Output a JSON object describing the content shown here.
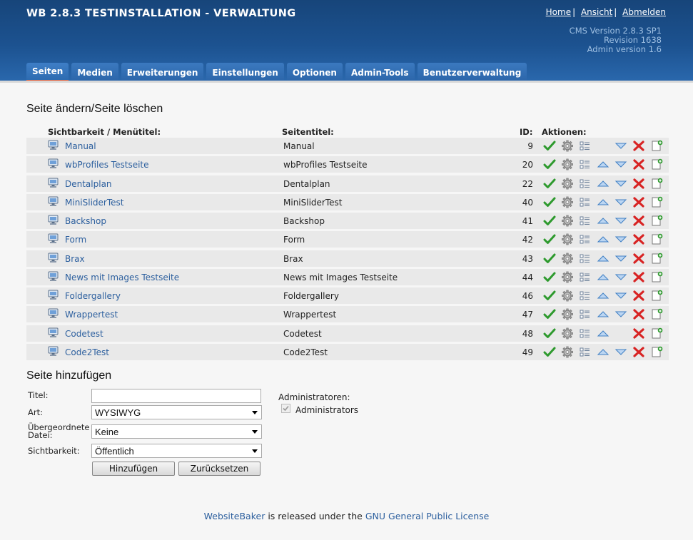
{
  "header": {
    "title": "WB 2.8.3 TESTINSTALLATION - VERWALTUNG",
    "links": [
      "Home",
      "Ansicht",
      "Abmelden"
    ],
    "version_lines": [
      "CMS Version 2.8.3 SP1",
      "Revision 1638",
      "Admin version 1.6"
    ]
  },
  "tabs": [
    "Seiten",
    "Medien",
    "Erweiterungen",
    "Einstellungen",
    "Optionen",
    "Admin-Tools",
    "Benutzerverwaltung"
  ],
  "pages_section": {
    "heading": "Seite ändern/Seite löschen",
    "columns": {
      "menu_title": "Sichtbarkeit / Menütitel:",
      "page_title": "Seitentitel:",
      "id": "ID:",
      "actions": "Aktionen:"
    },
    "rows": [
      {
        "menu": "Manual",
        "title": "Manual",
        "id": "9",
        "up": false,
        "down": true
      },
      {
        "menu": "wbProfiles Testseite",
        "title": "wbProfiles Testseite",
        "id": "20",
        "up": true,
        "down": true
      },
      {
        "menu": "Dentalplan",
        "title": "Dentalplan",
        "id": "22",
        "up": true,
        "down": true
      },
      {
        "menu": "MiniSliderTest",
        "title": "MiniSliderTest",
        "id": "40",
        "up": true,
        "down": true
      },
      {
        "menu": "Backshop",
        "title": "Backshop",
        "id": "41",
        "up": true,
        "down": true
      },
      {
        "menu": "Form",
        "title": "Form",
        "id": "42",
        "up": true,
        "down": true
      },
      {
        "menu": "Brax",
        "title": "Brax",
        "id": "43",
        "up": true,
        "down": true
      },
      {
        "menu": "News mit Images Testseite",
        "title": "News mit Images Testseite",
        "id": "44",
        "up": true,
        "down": true
      },
      {
        "menu": "Foldergallery",
        "title": "Foldergallery",
        "id": "46",
        "up": true,
        "down": true
      },
      {
        "menu": "Wrappertest",
        "title": "Wrappertest",
        "id": "47",
        "up": true,
        "down": true
      },
      {
        "menu": "Codetest",
        "title": "Codetest",
        "id": "48",
        "up": true,
        "down": false
      },
      {
        "menu": "Code2Test",
        "title": "Code2Test",
        "id": "49",
        "up": true,
        "down": true
      }
    ]
  },
  "add_section": {
    "heading": "Seite hinzufügen",
    "title_label": "Titel:",
    "title_value": "",
    "type_label": "Art:",
    "type_value": "WYSIWYG",
    "parent_label_1": "Übergeordnete",
    "parent_label_2": "Datei:",
    "parent_value": "Keine",
    "visibility_label": "Sichtbarkeit:",
    "visibility_value": "Öffentlich",
    "admins_label": "Administratoren:",
    "admins_option": "Administrators",
    "admins_checked": true,
    "add_button": "Hinzufügen",
    "reset_button": "Zurücksetzen"
  },
  "footer": {
    "link1": "WebsiteBaker",
    "middle": " is released under the ",
    "link2": "GNU General Public License"
  },
  "colors": {
    "header_top": "#17457a",
    "tab_bg": "#2b65a9",
    "tab_active_border": "#e55d38",
    "link": "#2c5f9e",
    "row_bg": "#e9e9e9"
  }
}
